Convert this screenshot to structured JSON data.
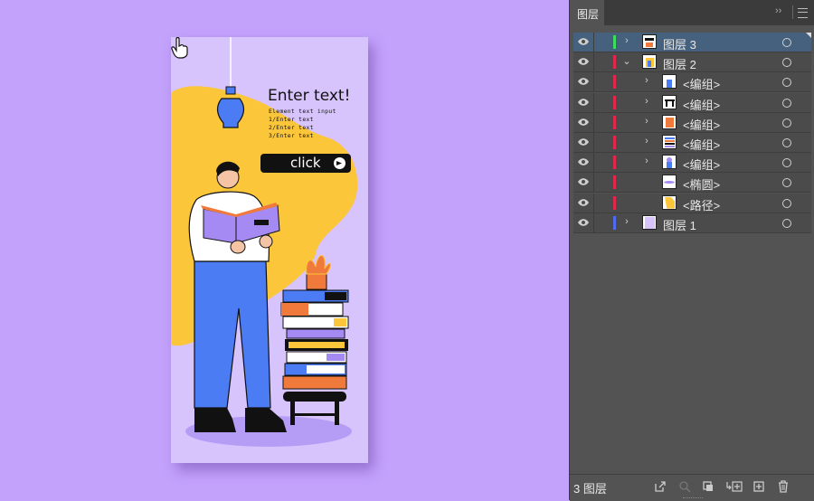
{
  "artboard": {
    "headline": "Enter text!",
    "subtitle_lines": [
      "Element text input",
      "1/Enter text",
      "2/Enter text",
      "3/Enter text"
    ],
    "button_label": "click",
    "colors": {
      "background": "#d8c4fd",
      "blob": "#fbc63a",
      "shirt": "#ffffff",
      "pants": "#4b7cf3",
      "book": "#a58af4",
      "dark": "#111111"
    }
  },
  "panel": {
    "tab_label": "图层",
    "collapse_icon": "double-chevron-icon",
    "menu_icon": "hamburger-menu-icon",
    "layers": [
      {
        "name": "图层 3",
        "expanded": false,
        "selected": true,
        "color": "#3ddc5c",
        "level": 0
      },
      {
        "name": "图层 2",
        "expanded": true,
        "selected": false,
        "color": "#e0284c",
        "level": 0
      },
      {
        "name": "<编组>",
        "expanded": false,
        "selected": false,
        "color": "#e0284c",
        "level": 1
      },
      {
        "name": "<编组>",
        "expanded": false,
        "selected": false,
        "color": "#e0284c",
        "level": 1
      },
      {
        "name": "<编组>",
        "expanded": false,
        "selected": false,
        "color": "#e0284c",
        "level": 1
      },
      {
        "name": "<编组>",
        "expanded": false,
        "selected": false,
        "color": "#e0284c",
        "level": 1
      },
      {
        "name": "<编组>",
        "expanded": false,
        "selected": false,
        "color": "#e0284c",
        "level": 1
      },
      {
        "name": "<椭圆>",
        "expanded": null,
        "selected": false,
        "color": "#e0284c",
        "level": 1
      },
      {
        "name": "<路径>",
        "expanded": null,
        "selected": false,
        "color": "#e0284c",
        "level": 1
      },
      {
        "name": "图层 1",
        "expanded": false,
        "selected": false,
        "color": "#4f6cf0",
        "level": 0
      }
    ],
    "footer": {
      "layer_count": "3 图层",
      "icons": [
        "export-icon",
        "search-icon",
        "clip-mask-icon",
        "new-sublayer-icon",
        "new-layer-icon",
        "trash-icon"
      ]
    }
  }
}
